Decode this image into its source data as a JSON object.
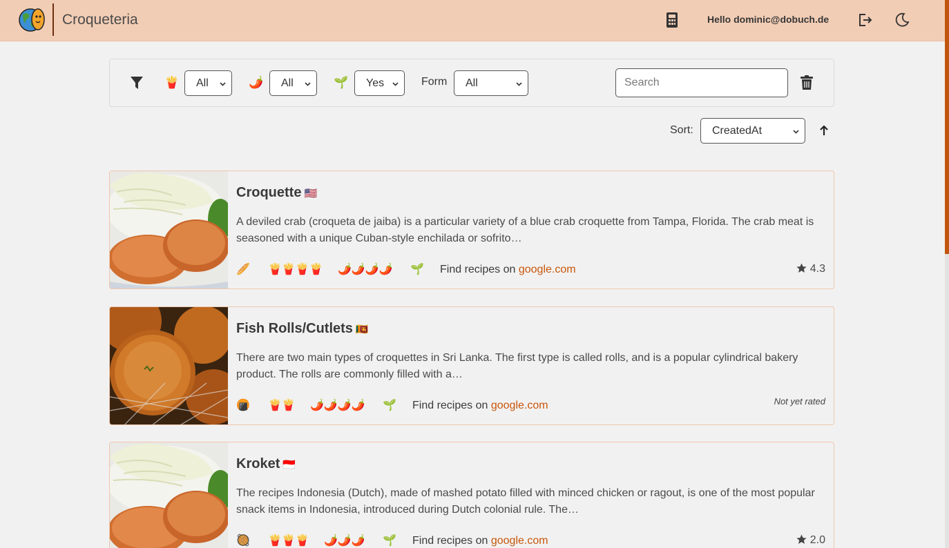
{
  "app": {
    "title": "Croqueteria",
    "greeting": "Hello dominic@dobuch.de"
  },
  "filters": {
    "fries_value": "All",
    "spice_value": "All",
    "veggie_value": "Yes",
    "form_label": "Form",
    "form_value": "All",
    "search_placeholder": "Search",
    "fries_icon": "🍟",
    "spice_icon": "🌶️",
    "veggie_icon": "🌱"
  },
  "sort": {
    "label": "Sort:",
    "value": "CreatedAt"
  },
  "cards": [
    {
      "title": "Croquette",
      "flag": "🇺🇸",
      "description": "A deviled crab (croqueta de jaiba) is a particular variety of a blue crab croquette from Tampa, Florida. The crab meat is seasoned with a unique Cuban-style enchilada or sofrito…",
      "form_icon": "🥖",
      "fries": "🍟🍟🍟🍟",
      "spice": "🌶️🌶️🌶️🌶️",
      "veggie": "🌱",
      "recipe_prefix": "Find recipes on",
      "recipe_link": "google.com",
      "rating": "4.3"
    },
    {
      "title": "Fish Rolls/Cutlets",
      "flag": "🇱🇰",
      "description": "There are two main types of croquettes in Sri Lanka. The first type is called rolls, and is a popular cylindrical bakery product. The rolls are commonly filled with a…",
      "form_icon": "🍘",
      "fries": "🍟🍟",
      "spice": "🌶️🌶️🌶️🌶️",
      "veggie": "🌱",
      "recipe_prefix": "Find recipes on",
      "recipe_link": "google.com",
      "rating_text": "Not yet rated"
    },
    {
      "title": "Kroket",
      "flag": "🇮🇩",
      "description": "The recipes Indonesia (Dutch), made of mashed potato filled with minced chicken or ragout, is one of the most popular snack items in Indonesia, introduced during Dutch colonial rule. The…",
      "form_icon": "🥘",
      "fries": "🍟🍟🍟",
      "spice": "🌶️🌶️🌶️",
      "veggie": "🌱",
      "recipe_prefix": "Find recipes on",
      "recipe_link": "google.com",
      "rating": "2.0"
    }
  ],
  "colors": {
    "navbar": "#f2cdb5",
    "accent": "#c8560a",
    "card_border": "#efc7ae"
  }
}
